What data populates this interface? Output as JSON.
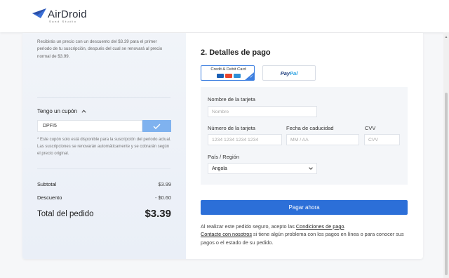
{
  "header": {
    "logo_name": "AirDroid",
    "logo_sub": "Sand Studio"
  },
  "summary": {
    "notice": "Recibirás un precio con un descuento del $3.39 para el primer periodo de tu suscripción, después del cual se renovará al precio normal de $3.99.",
    "coupon_title": "Tengo un cupón",
    "coupon_value": "DPFI5",
    "coupon_note": "* Este cupón solo está disponible para la suscripción del periodo actual. Las suscripciones se renovarán automáticamente y se cobrarán según el precio original.",
    "subtotal_label": "Subtotal",
    "subtotal_value": "$3.99",
    "discount_label": "Descuento",
    "discount_value": "- $0.60",
    "total_label": "Total del pedido",
    "total_value": "$3.39"
  },
  "payment": {
    "title": "2. Detalles de pago",
    "method_card_label": "Credit & Debit Card",
    "method_paypal_pay": "Pay",
    "method_paypal_pal": "Pal",
    "card_name_label": "Nombre de la tarjeta",
    "card_name_placeholder": "Nombre",
    "card_number_label": "Número de la tarjeta",
    "card_number_placeholder": "1234 1234 1234 1234",
    "expiry_label": "Fecha de caducidad",
    "expiry_placeholder": "MM / AA",
    "cvv_label": "CVV",
    "cvv_placeholder": "CVV",
    "country_label": "País / Región",
    "country_value": "Angola",
    "pay_button": "Pagar ahora",
    "legal_1": "Al realizar este pedido seguro, acepto las ",
    "legal_terms_link": "Condiciones de pago",
    "legal_2": ".",
    "legal_contact_link": "Contacte con nosotros",
    "legal_3": " si tiene algún problema con los pagos en línea o para conocer sus pagos o el estado de su pedido."
  },
  "colors": {
    "accent": "#2c6fd8",
    "coupon_button": "#7fb2ef",
    "paypal_dark": "#1d3c7c",
    "paypal_light": "#2aa0e0"
  },
  "icons": {
    "logo": "airdroid-plane-icon",
    "coupon_toggle": "chevron-up-icon",
    "coupon_apply": "check-icon",
    "country_select": "chevron-down-icon",
    "method_selected": "check-corner-icon"
  }
}
